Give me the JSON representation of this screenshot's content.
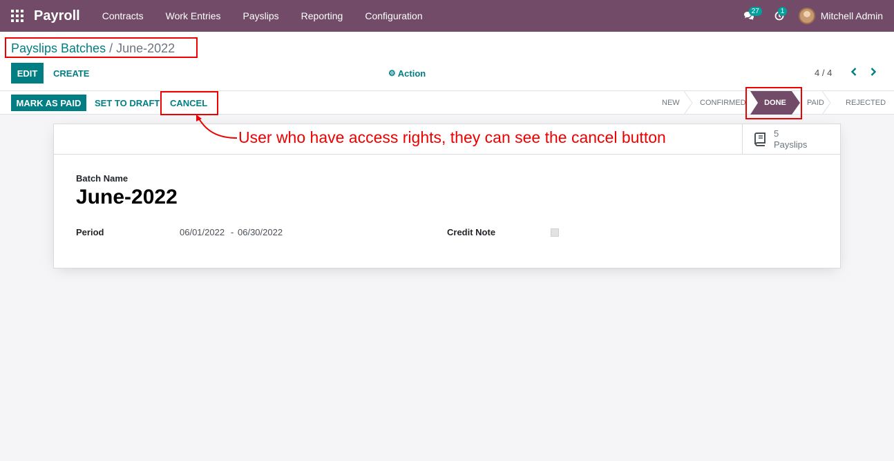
{
  "navbar": {
    "app_name": "Payroll",
    "menu": [
      "Contracts",
      "Work Entries",
      "Payslips",
      "Reporting",
      "Configuration"
    ],
    "messages_count": "27",
    "activities_count": "1",
    "user_name": "Mitchell Admin"
  },
  "breadcrumb": {
    "parent": "Payslips Batches",
    "separator": "/",
    "current": "June-2022"
  },
  "control_panel": {
    "edit_label": "EDIT",
    "create_label": "CREATE",
    "action_label": "Action",
    "pager": "4 / 4"
  },
  "statusbar": {
    "buttons": {
      "mark_as_paid": "MARK AS PAID",
      "set_to_draft": "SET TO DRAFT",
      "cancel": "CANCEL"
    },
    "stages": [
      "NEW",
      "CONFIRMED",
      "DONE",
      "PAID",
      "REJECTED"
    ],
    "active_stage": "DONE"
  },
  "form": {
    "smart_button": {
      "count": "5",
      "label": "Payslips"
    },
    "batch_name_label": "Batch Name",
    "batch_name": "June-2022",
    "period_label": "Period",
    "period_start": "06/01/2022",
    "period_separator": "-",
    "period_end": "06/30/2022",
    "credit_note_label": "Credit Note",
    "credit_note_checked": false
  },
  "annotation": {
    "text": "User who have access rights, they can see the cancel button",
    "color": "#e00000"
  },
  "colors": {
    "navbar": "#714b67",
    "primary": "#017e84",
    "active_stage": "#714b67"
  },
  "icons": [
    "apps-grid-icon",
    "chat-icon",
    "clock-icon",
    "gear-icon",
    "chevron-left-icon",
    "chevron-right-icon",
    "book-icon"
  ]
}
